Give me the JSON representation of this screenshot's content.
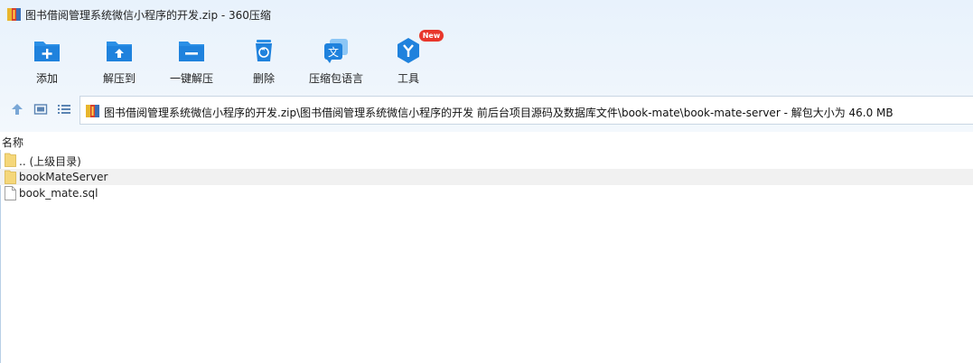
{
  "window": {
    "title": "图书借阅管理系统微信小程序的开发.zip - 360压缩"
  },
  "toolbar": {
    "items": [
      {
        "label": "添加",
        "icon": "add-icon"
      },
      {
        "label": "解压到",
        "icon": "extract-to-icon"
      },
      {
        "label": "一键解压",
        "icon": "one-click-extract-icon"
      },
      {
        "label": "删除",
        "icon": "delete-icon"
      },
      {
        "label": "压缩包语言",
        "icon": "archive-language-icon"
      },
      {
        "label": "工具",
        "icon": "tools-icon",
        "badge": "New"
      }
    ]
  },
  "nav": {
    "path": "图书借阅管理系统微信小程序的开发.zip\\图书借阅管理系统微信小程序的开发 前后台项目源码及数据库文件\\book-mate\\book-mate-server - 解包大小为 46.0 MB"
  },
  "file_list": {
    "column_name": "名称",
    "rows": [
      {
        "name": ".. (上级目录)",
        "type": "folder",
        "selected": false
      },
      {
        "name": "bookMateServer",
        "type": "folder",
        "selected": true
      },
      {
        "name": "book_mate.sql",
        "type": "file",
        "selected": false
      }
    ]
  },
  "colors": {
    "accent": "#2a8fe6",
    "badge": "#e8372c",
    "folder": "#f5d77a"
  }
}
